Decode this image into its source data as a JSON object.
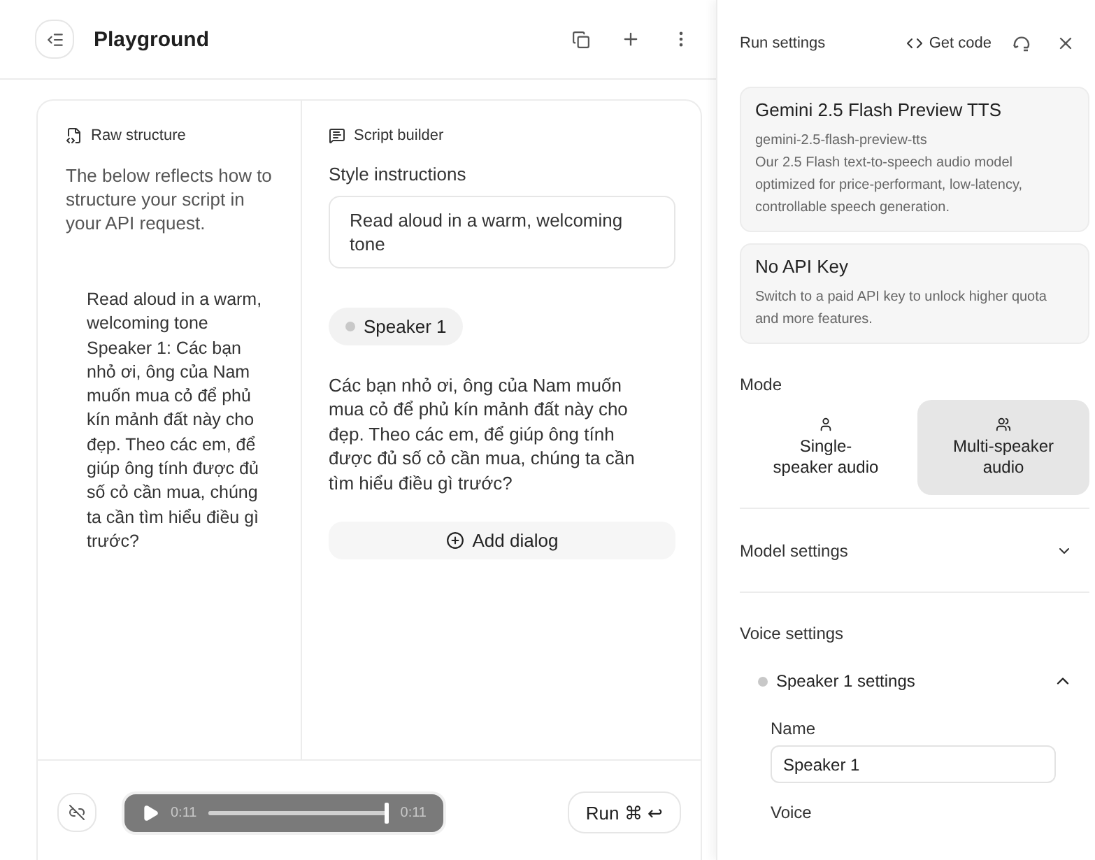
{
  "header": {
    "title": "Playground"
  },
  "raw_structure": {
    "heading": "Raw structure",
    "description": "The below reflects how to structure your script in your API request.",
    "script": [
      "Read aloud in a warm, welcoming tone",
      "Speaker 1: Các bạn nhỏ ơi, ông của Nam muốn mua cỏ để phủ kín mảnh đất này cho đẹp. Theo các em, để giúp ông tính được đủ số cỏ cần mua, chúng ta cần tìm hiểu điều gì trước?"
    ]
  },
  "script_builder": {
    "heading": "Script builder",
    "style_label": "Style instructions",
    "style_value": "Read aloud in a warm, welcoming tone",
    "speaker": "Speaker 1",
    "dialog": "Các bạn nhỏ ơi, ông của Nam muốn mua cỏ để phủ kín mảnh đất này cho đẹp. Theo các em, để giúp ông tính được đủ số cỏ cần mua, chúng ta cần tìm hiểu điều gì trước?",
    "add_button": "Add dialog"
  },
  "player": {
    "elapsed": "0:11",
    "level": 1,
    "duration": "0:11"
  },
  "run_button": {
    "label": "Run",
    "shortcut": "⌘ ↩"
  },
  "run_settings": {
    "title": "Run settings",
    "get_code": "Get code",
    "model": {
      "name": "Gemini 2.5 Flash Preview TTS",
      "id": "gemini-2.5-flash-preview-tts",
      "description": "Our 2.5 Flash text-to-speech audio model optimized for price-performant, low-latency, controllable speech generation."
    },
    "api_key": {
      "title": "No API Key",
      "description": "Switch to a paid API key to unlock higher quota and more features."
    },
    "mode_label": "Mode",
    "modes": [
      {
        "label": "Single-speaker audio",
        "kind": "single",
        "selected": false
      },
      {
        "label": "Multi-speaker audio",
        "kind": "multi",
        "selected": true
      }
    ],
    "sections": [
      {
        "title": "Model settings",
        "expanded": false
      }
    ],
    "voice_settings": {
      "title": "Voice settings",
      "speaker": {
        "title": "Speaker 1 settings",
        "expanded": true,
        "name_label": "Name",
        "name_value": "Speaker 1",
        "voice_label": "Voice"
      }
    }
  }
}
